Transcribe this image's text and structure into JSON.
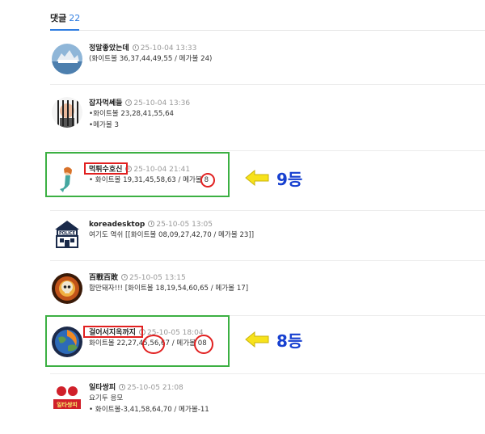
{
  "header": {
    "label": "댓글",
    "count": "22"
  },
  "comments": [
    {
      "nickname": "정말좋았는데",
      "time": "25-10-04 13:33",
      "lines": [
        "(화이트볼 36,37,44,49,55 / 메가볼 24)"
      ],
      "avatar": "ship-photo-avatar"
    },
    {
      "nickname": "잡자먹쎄들",
      "time": "25-10-04 13:36",
      "lines": [
        "•화이트볼 23,28,41,55,64",
        "•메가볼 3"
      ],
      "avatar": "prisoner-avatar"
    },
    {
      "nickname": "먹튀수호신",
      "time": "25-10-04 21:41",
      "lines": [
        "• 화이트볼 19,31,45,58,63 / 메가볼 8"
      ],
      "avatar": "mermaid-avatar"
    },
    {
      "nickname": "koreadesktop",
      "time": "25-10-05 13:05",
      "lines": [
        "여기도 역쉬 [[화이트볼 08,09,27,42,70 / 메가볼 23]]"
      ],
      "avatar": "police-avatar"
    },
    {
      "nickname": "百戰百敗",
      "time": "25-10-05 13:15",
      "lines": [
        "함만돼자!!! [화이트볼 18,19,54,60,65 / 메가볼 17]"
      ],
      "avatar": "skull-fire-avatar"
    },
    {
      "nickname": "걸어서지옥까지",
      "time": "25-10-05 18:04",
      "lines": [
        "화이트볼 22,27,45,56,67 / 메가볼 08"
      ],
      "avatar": "earth-fire-avatar"
    },
    {
      "nickname": "일타쌍피",
      "time": "25-10-05 21:08",
      "lines": [
        "요기두 응모",
        "• 화이트볼-3,41,58,64,70 / 메가볼-11"
      ],
      "avatar": "ilta-avatar"
    }
  ],
  "annotations": [
    {
      "label": "9등",
      "arrow_color": "#f7e21b"
    },
    {
      "label": "8등",
      "arrow_color": "#f7e21b"
    }
  ],
  "colors": {
    "accent": "#2f7de1",
    "highlight_green": "#3cb043",
    "highlight_red": "#e12020",
    "rank_text": "#1740d0"
  }
}
